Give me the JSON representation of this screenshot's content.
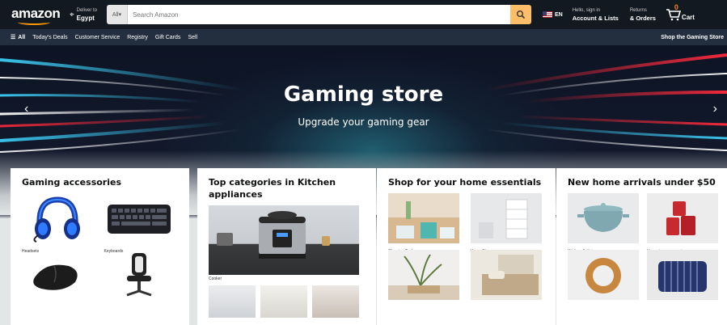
{
  "header": {
    "logo": "amazon",
    "deliver_line1": "Deliver to",
    "deliver_line2": "Egypt",
    "search_category": "All",
    "search_placeholder": "Search Amazon",
    "language": "EN",
    "account_line1": "Hello, sign in",
    "account_line2": "Account & Lists",
    "orders_line1": "Returns",
    "orders_line2": "& Orders",
    "cart_count": "0",
    "cart_label": "Cart"
  },
  "nav": {
    "all_label": "All",
    "items": [
      "Today's Deals",
      "Customer Service",
      "Registry",
      "Gift Cards",
      "Sell"
    ],
    "right_label": "Shop the Gaming Store"
  },
  "hero": {
    "title": "Gaming store",
    "subtitle": "Upgrade your gaming gear"
  },
  "cards": [
    {
      "title": "Gaming accessories",
      "tiles": [
        {
          "caption": "Headsets",
          "icon": "headset-image"
        },
        {
          "caption": "Keyboards",
          "icon": "keyboard-image"
        },
        {
          "caption": "",
          "icon": "mouse-image"
        },
        {
          "caption": "",
          "icon": "chair-image"
        }
      ]
    },
    {
      "title": "Top categories in Kitchen appliances",
      "main_caption": "Cooker",
      "main_icon": "pressure-cooker-image"
    },
    {
      "title": "Shop for your home essentials",
      "tiles": [
        {
          "caption": "Cleaning Tools",
          "icon": "cleaning-tools-image"
        },
        {
          "caption": "Home Storage",
          "icon": "home-storage-image"
        },
        {
          "caption": "",
          "icon": "home-decor-image"
        },
        {
          "caption": "",
          "icon": "bedding-image"
        }
      ]
    },
    {
      "title": "New home arrivals under $50",
      "tiles": [
        {
          "caption": "Kitchen & dining",
          "icon": "dutch-oven-image"
        },
        {
          "caption": "Home improvement",
          "icon": "canisters-image"
        },
        {
          "caption": "",
          "icon": "mirror-image"
        },
        {
          "caption": "",
          "icon": "pillow-image"
        }
      ]
    }
  ],
  "colors": {
    "header_bg": "#131921",
    "nav_bg": "#232f3e",
    "search_button": "#febd69",
    "accent": "#ff9900"
  }
}
